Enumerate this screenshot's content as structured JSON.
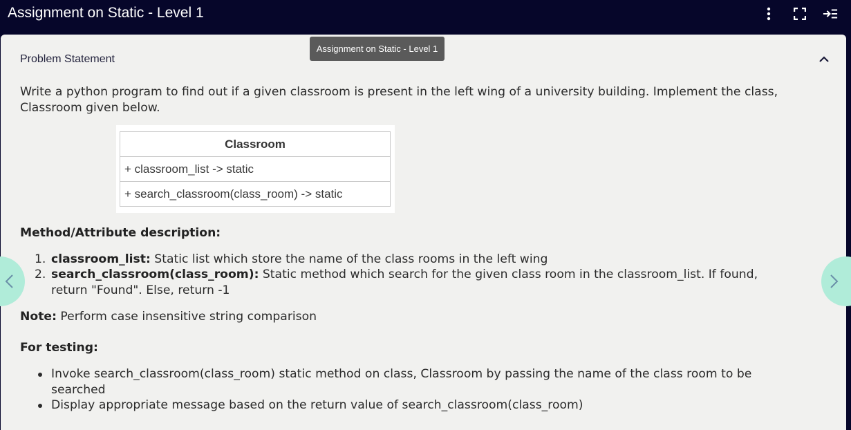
{
  "header": {
    "title": "Assignment on Static - Level 1",
    "icons": [
      "more-vertical-icon",
      "fullscreen-icon",
      "collapse-panel-icon"
    ]
  },
  "tooltip": {
    "text": "Assignment on Static - Level 1"
  },
  "problem": {
    "section_title": "Problem Statement",
    "intro_line1": "Write a python program to find out if a given classroom is present in the left wing of a university building. Implement the class,",
    "intro_line2": "Classroom given below.",
    "uml": {
      "class_name": "Classroom",
      "attribute": "+ classroom_list -> static",
      "method": "+ search_classroom(class_room) -> static"
    },
    "method_heading": "Method/Attribute description:",
    "descriptions": [
      {
        "number": "1.",
        "term": "classroom_list:",
        "text": " Static list which store the name of the class rooms in the left wing"
      },
      {
        "number": "2.",
        "term": "search_classroom(class_room):",
        "text": " Static method which search for the given class room in the classroom_list. If found,",
        "text_cont": "return \"Found\". Else, return -1"
      }
    ],
    "note_label": "Note:",
    "note_text": " Perform case insensitive string comparison",
    "testing_heading": "For testing:",
    "testing_items": [
      {
        "line1": "Invoke search_classroom(class_room) static method on class, Classroom by passing the name of the class room to be",
        "line2": "searched"
      },
      {
        "line1": "Display appropriate message based on the return value of search_classroom(class_room)"
      }
    ]
  },
  "navigation": {
    "prev_icon": "chevron-left-icon",
    "next_icon": "chevron-right-icon"
  },
  "colors": {
    "header_bg": "#06062a",
    "panel_bg": "#f1f1ef",
    "nav_bg": "#b0ecd9",
    "tooltip_bg": "#5a5a5a"
  }
}
